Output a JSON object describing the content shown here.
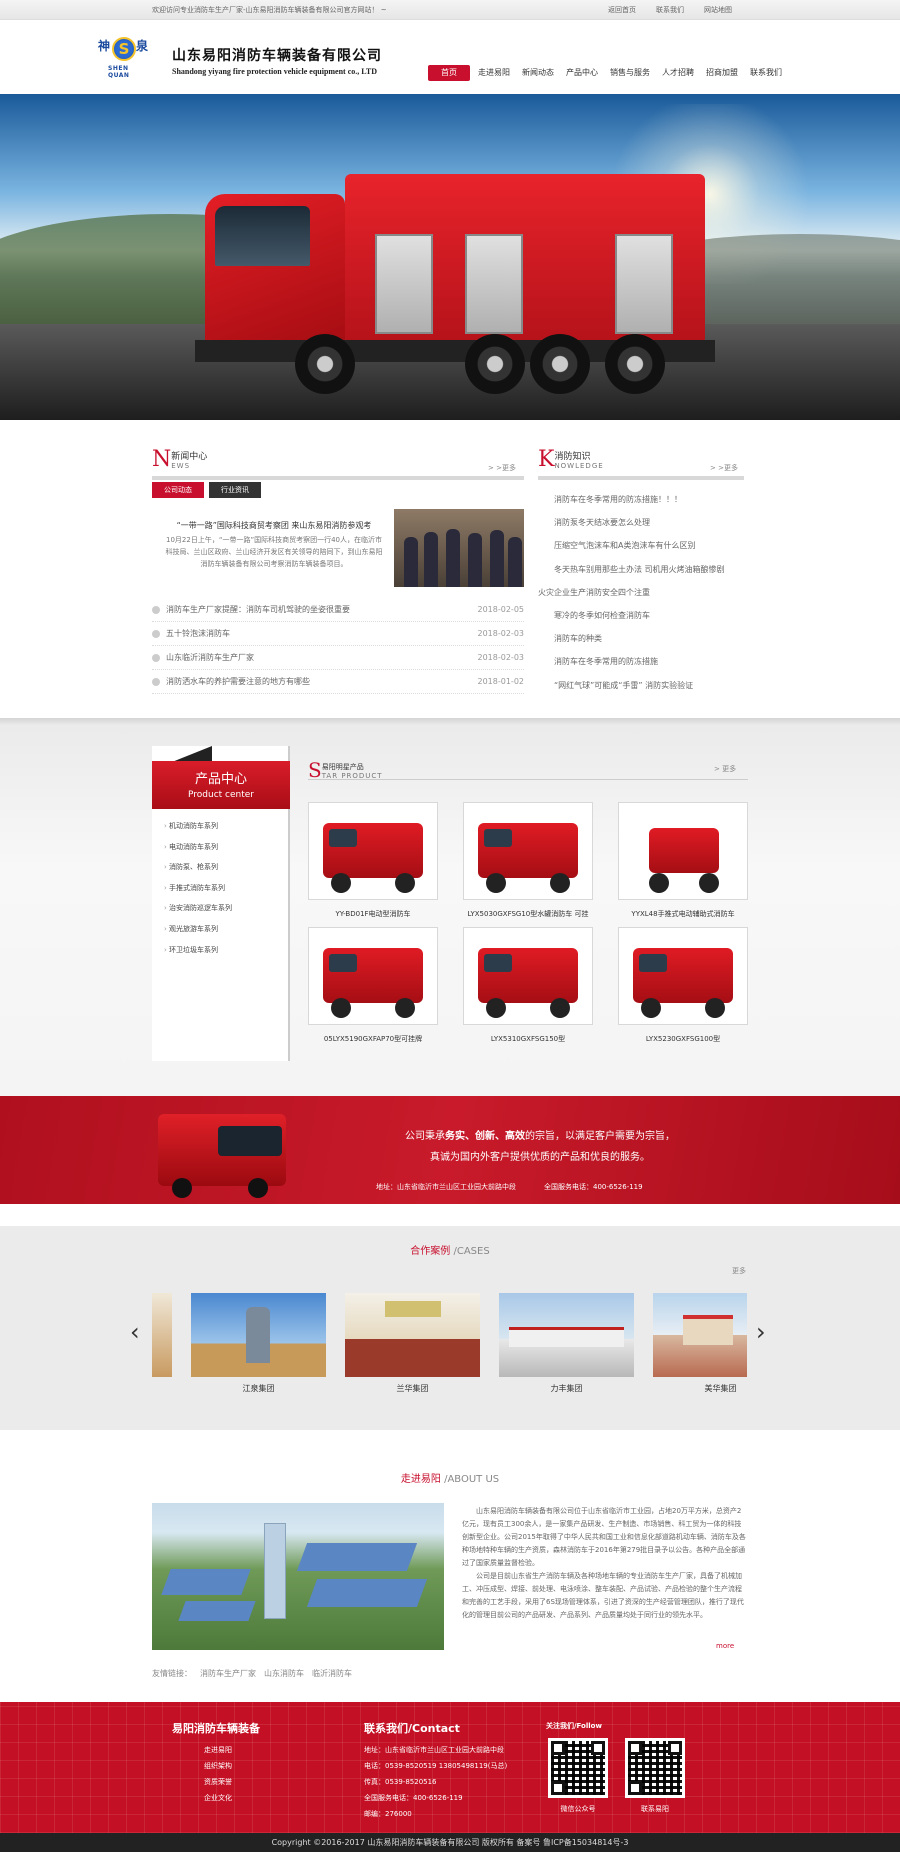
{
  "topbar": {
    "welcome": "欢迎访问专业消防车生产厂家-山东易阳消防车辆装备有限公司官方网站！ ~",
    "links": [
      "返回首页",
      "联系我们",
      "网站地图"
    ]
  },
  "header": {
    "logo_char1": "神",
    "logo_char2": "泉",
    "logo_letter": "S",
    "logo_en": "SHEN QUAN",
    "company_name": "山东易阳消防车辆装备有限公司",
    "company_name_en": "Shandong yiyang fire protection vehicle equipment co., LTD"
  },
  "nav": {
    "items": [
      "首页",
      "走进易阳",
      "新闻动态",
      "产品中心",
      "销售与服务",
      "人才招聘",
      "招商加盟",
      "联系我们"
    ]
  },
  "news": {
    "big_letter": "N",
    "title": "新闻中心",
    "title_en": "EWS",
    "more": "> >更多",
    "tabs": [
      "公司动态",
      "行业资讯"
    ],
    "feature_title": "“一带一路”国际科技商贸考察团 来山东易阳消防参观考",
    "feature_body": "10月22日上午，“一带一路”国际科技商贸考察团一行40人，在临沂市科技局、兰山区政府、兰山经济开发区有关领导的陪同下，到山东易阳消防车辆装备有限公司考察消防车辆装备项目。",
    "list": [
      {
        "title": "消防车生产厂家提醒：消防车司机驾驶的坐姿很重要",
        "date": "2018-02-05"
      },
      {
        "title": "五十铃泡沫消防车",
        "date": "2018-02-03"
      },
      {
        "title": "山东临沂消防车生产厂家",
        "date": "2018-02-03"
      },
      {
        "title": "消防洒水车的养护需要注意的地方有哪些",
        "date": "2018-01-02"
      }
    ]
  },
  "knowledge": {
    "big_letter": "K",
    "title": "消防知识",
    "title_en": "NOWLEDGE",
    "more": "> >更多",
    "items": [
      "消防车在冬季常用的防冻措施！！！",
      "消防泵冬天结冰要怎么处理",
      "压缩空气泡沫车和A类泡沫车有什么区别",
      "冬天热车别用那些土办法 司机用火烤油箱酿惨剧",
      "火灾企业生产消防安全四个注重",
      "寒冷的冬季如何检查消防车",
      "消防车的种类",
      "消防车在冬季常用的防冻措施",
      "“网红气球”可能成“手雷” 消防实验验证"
    ]
  },
  "products": {
    "side_title": "产品中心",
    "side_title_en": "Product center",
    "categories": [
      "机动消防车系列",
      "电动消防车系列",
      "消防泵、枪系列",
      "手推式消防车系列",
      "治安消防巡逻车系列",
      "观光旅游车系列",
      "环卫垃圾车系列"
    ],
    "hot_letter": "S",
    "hot_title": "易阳明星产品",
    "hot_title_en": "TAR PRODUCT",
    "more": "> 更多",
    "items": [
      {
        "name": "YY-BD01F电动型消防车"
      },
      {
        "name": "LYX5030GXFSG10型水罐消防车 可挂"
      },
      {
        "name": "YYXL48手推式电动辅助式消防车"
      },
      {
        "name": "05LYX5190GXFAP70型可挂牌"
      },
      {
        "name": "LYX5310GXFSG150型"
      },
      {
        "name": "LYX5230GXFSG100型"
      }
    ]
  },
  "slogan": {
    "line1_a": "公司秉承",
    "line1_b": "务实、创新、高效",
    "line1_c": "的宗旨，以满足客户需要为宗旨，",
    "line2": "真诚为国内外客户提供优质的产品和优良的服务。",
    "address": "地址：山东省临沂市兰山区工业园大前路中段",
    "hotline": "全国服务电话：400-6526-119"
  },
  "cases": {
    "title_cn": "合作案例",
    "title_en": " /CASES",
    "more": "更多",
    "items": [
      "江泉集团",
      "兰华集团",
      "力丰集团",
      "美华集团"
    ]
  },
  "about": {
    "title_cn": "走进易阳",
    "title_en": " /ABOUT US",
    "p1": "山东易阳消防车辆装备有限公司位于山东省临沂市工业园，占地20万平方米，总资产2亿元，现有员工300余人，是一家集产品研发、生产制造、市场销售、科工贸为一体的科技创新型企业。公司2015年取得了中华人民共和国工业和信息化部道路机动车辆、消防车及各种场地特种车辆的生产资质，森林消防车于2016年第279批目录予以公告。各种产品全部通过了国家质量监督检验。",
    "p2": "公司是目前山东省生产消防车辆及各种场地车辆的专业消防车生产厂家，具备了机械加工、冲压成型、焊接、前处理、电泳喷涂、整车装配、产品试验、产品检验的整个生产流程和完善的工艺手段，采用了6S现场管理体系，引进了资深的生产经营管理团队，推行了现代化的管理目前公司的产品研发、产品系列、产品质量均处于同行业的领先水平。",
    "more": "more"
  },
  "friend_links": {
    "label": "友情链接：",
    "items": [
      "消防车生产厂家",
      "山东消防车",
      "临沂消防车"
    ]
  },
  "footer": {
    "col1_title": "易阳消防车辆装备",
    "col1_items": [
      "走进易阳",
      "组织架构",
      "资质荣誉",
      "企业文化"
    ],
    "col2_title": "联系我们/Contact",
    "col2_items": [
      "地址：山东省临沂市兰山区工业园大前路中段",
      "电话：0539-8520519 13805498119(马总)",
      "传真：0539-8520516",
      "全国服务电话：400-6526-119",
      "邮编：276000"
    ],
    "follow": "关注我们/Follow",
    "qr1": "微信公众号",
    "qr2": "联系易阳"
  },
  "copyright": "Copyright ©2016-2017 山东易阳消防车辆装备有限公司 版权所有  备案号 鲁ICP备15034814号-3"
}
